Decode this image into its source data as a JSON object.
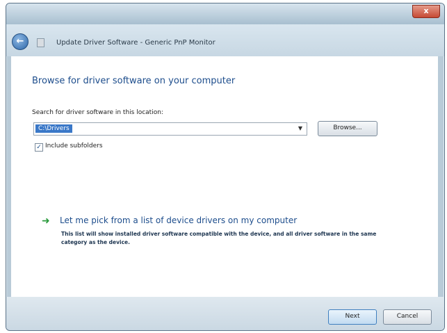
{
  "window": {
    "close_glyph": "x"
  },
  "nav": {
    "title": "Update Driver Software - Generic PnP Monitor"
  },
  "main": {
    "heading": "Browse for driver software on your computer",
    "search_label": "Search for driver software in this location:",
    "location_value": "C:\\Drivers",
    "browse_label": "Browse...",
    "include_subfolders_label": "Include subfolders",
    "include_subfolders_checked": true,
    "pick_title": "Let me pick from a list of device drivers on my computer",
    "pick_description": "This list will show installed driver software compatible with the device, and all driver software in the same category as the device."
  },
  "footer": {
    "next_label": "Next",
    "cancel_label": "Cancel"
  },
  "icons": {
    "back": "back-arrow-icon",
    "pick": "green-arrow-icon",
    "checkbox": "check-mark-icon"
  },
  "colors": {
    "heading": "#1d4d8c",
    "selection": "#3a78c8",
    "arrow": "#2a9a3c"
  }
}
